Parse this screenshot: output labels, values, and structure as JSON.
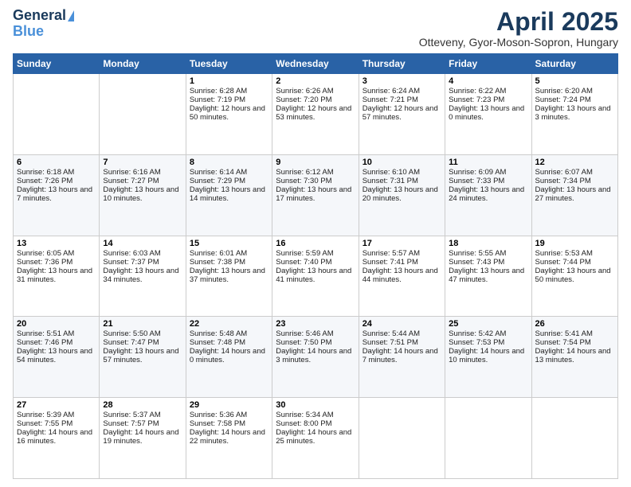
{
  "logo": {
    "line1": "General",
    "line2": "Blue"
  },
  "header": {
    "title": "April 2025",
    "subtitle": "Otteveny, Gyor-Moson-Sopron, Hungary"
  },
  "weekdays": [
    "Sunday",
    "Monday",
    "Tuesday",
    "Wednesday",
    "Thursday",
    "Friday",
    "Saturday"
  ],
  "weeks": [
    [
      {
        "day": "",
        "data": ""
      },
      {
        "day": "",
        "data": ""
      },
      {
        "day": "1",
        "data": "Sunrise: 6:28 AM\nSunset: 7:19 PM\nDaylight: 12 hours and 50 minutes."
      },
      {
        "day": "2",
        "data": "Sunrise: 6:26 AM\nSunset: 7:20 PM\nDaylight: 12 hours and 53 minutes."
      },
      {
        "day": "3",
        "data": "Sunrise: 6:24 AM\nSunset: 7:21 PM\nDaylight: 12 hours and 57 minutes."
      },
      {
        "day": "4",
        "data": "Sunrise: 6:22 AM\nSunset: 7:23 PM\nDaylight: 13 hours and 0 minutes."
      },
      {
        "day": "5",
        "data": "Sunrise: 6:20 AM\nSunset: 7:24 PM\nDaylight: 13 hours and 3 minutes."
      }
    ],
    [
      {
        "day": "6",
        "data": "Sunrise: 6:18 AM\nSunset: 7:26 PM\nDaylight: 13 hours and 7 minutes."
      },
      {
        "day": "7",
        "data": "Sunrise: 6:16 AM\nSunset: 7:27 PM\nDaylight: 13 hours and 10 minutes."
      },
      {
        "day": "8",
        "data": "Sunrise: 6:14 AM\nSunset: 7:29 PM\nDaylight: 13 hours and 14 minutes."
      },
      {
        "day": "9",
        "data": "Sunrise: 6:12 AM\nSunset: 7:30 PM\nDaylight: 13 hours and 17 minutes."
      },
      {
        "day": "10",
        "data": "Sunrise: 6:10 AM\nSunset: 7:31 PM\nDaylight: 13 hours and 20 minutes."
      },
      {
        "day": "11",
        "data": "Sunrise: 6:09 AM\nSunset: 7:33 PM\nDaylight: 13 hours and 24 minutes."
      },
      {
        "day": "12",
        "data": "Sunrise: 6:07 AM\nSunset: 7:34 PM\nDaylight: 13 hours and 27 minutes."
      }
    ],
    [
      {
        "day": "13",
        "data": "Sunrise: 6:05 AM\nSunset: 7:36 PM\nDaylight: 13 hours and 31 minutes."
      },
      {
        "day": "14",
        "data": "Sunrise: 6:03 AM\nSunset: 7:37 PM\nDaylight: 13 hours and 34 minutes."
      },
      {
        "day": "15",
        "data": "Sunrise: 6:01 AM\nSunset: 7:38 PM\nDaylight: 13 hours and 37 minutes."
      },
      {
        "day": "16",
        "data": "Sunrise: 5:59 AM\nSunset: 7:40 PM\nDaylight: 13 hours and 41 minutes."
      },
      {
        "day": "17",
        "data": "Sunrise: 5:57 AM\nSunset: 7:41 PM\nDaylight: 13 hours and 44 minutes."
      },
      {
        "day": "18",
        "data": "Sunrise: 5:55 AM\nSunset: 7:43 PM\nDaylight: 13 hours and 47 minutes."
      },
      {
        "day": "19",
        "data": "Sunrise: 5:53 AM\nSunset: 7:44 PM\nDaylight: 13 hours and 50 minutes."
      }
    ],
    [
      {
        "day": "20",
        "data": "Sunrise: 5:51 AM\nSunset: 7:46 PM\nDaylight: 13 hours and 54 minutes."
      },
      {
        "day": "21",
        "data": "Sunrise: 5:50 AM\nSunset: 7:47 PM\nDaylight: 13 hours and 57 minutes."
      },
      {
        "day": "22",
        "data": "Sunrise: 5:48 AM\nSunset: 7:48 PM\nDaylight: 14 hours and 0 minutes."
      },
      {
        "day": "23",
        "data": "Sunrise: 5:46 AM\nSunset: 7:50 PM\nDaylight: 14 hours and 3 minutes."
      },
      {
        "day": "24",
        "data": "Sunrise: 5:44 AM\nSunset: 7:51 PM\nDaylight: 14 hours and 7 minutes."
      },
      {
        "day": "25",
        "data": "Sunrise: 5:42 AM\nSunset: 7:53 PM\nDaylight: 14 hours and 10 minutes."
      },
      {
        "day": "26",
        "data": "Sunrise: 5:41 AM\nSunset: 7:54 PM\nDaylight: 14 hours and 13 minutes."
      }
    ],
    [
      {
        "day": "27",
        "data": "Sunrise: 5:39 AM\nSunset: 7:55 PM\nDaylight: 14 hours and 16 minutes."
      },
      {
        "day": "28",
        "data": "Sunrise: 5:37 AM\nSunset: 7:57 PM\nDaylight: 14 hours and 19 minutes."
      },
      {
        "day": "29",
        "data": "Sunrise: 5:36 AM\nSunset: 7:58 PM\nDaylight: 14 hours and 22 minutes."
      },
      {
        "day": "30",
        "data": "Sunrise: 5:34 AM\nSunset: 8:00 PM\nDaylight: 14 hours and 25 minutes."
      },
      {
        "day": "",
        "data": ""
      },
      {
        "day": "",
        "data": ""
      },
      {
        "day": "",
        "data": ""
      }
    ]
  ]
}
